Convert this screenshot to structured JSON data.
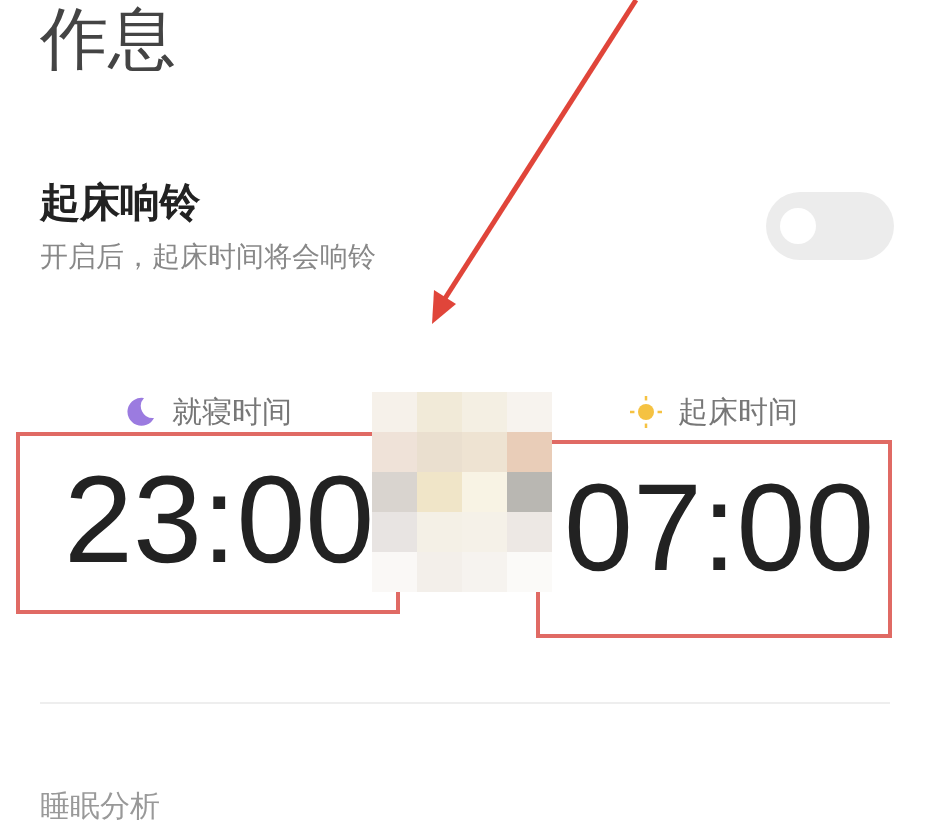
{
  "title": "作息",
  "alarm": {
    "label": "起床响铃",
    "description": "开启后，起床时间将会响铃",
    "on": false
  },
  "times": [
    {
      "kind": "bedtime",
      "label": "就寝时间",
      "time": "23:00",
      "highlighted": true
    },
    {
      "kind": "wake",
      "label": "起床时间",
      "time": "07:00",
      "highlighted": true
    }
  ],
  "section": "睡眠分析"
}
